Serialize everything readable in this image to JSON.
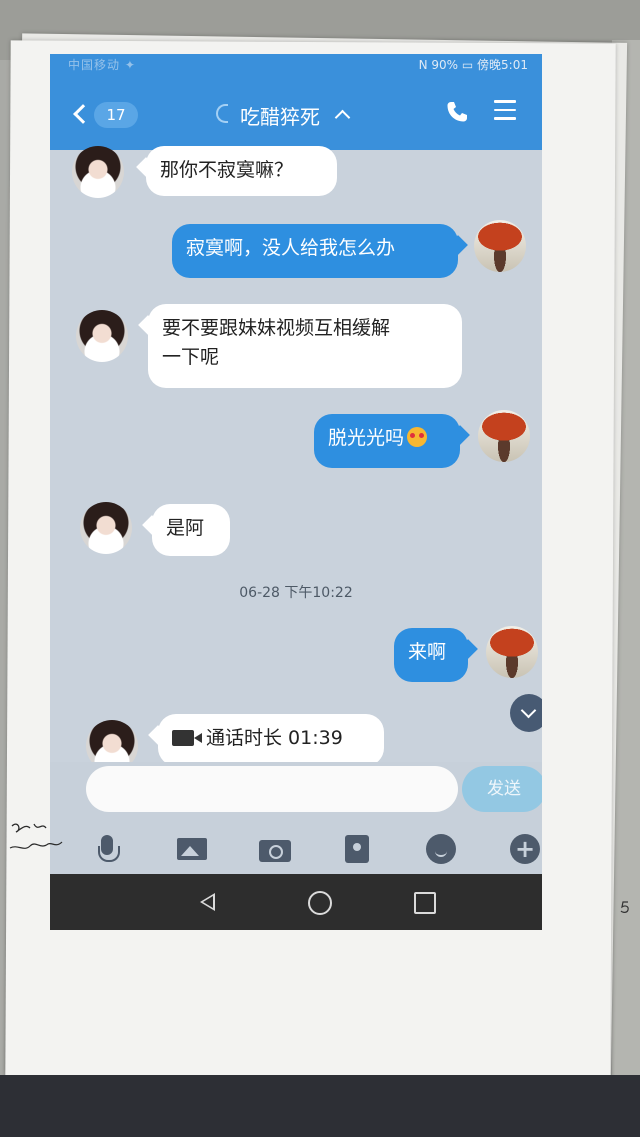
{
  "status_bar": {
    "left": "中国移动 ✦",
    "right": "N 90% ▭ 傍晚5:01"
  },
  "header": {
    "back_badge": "17",
    "title": "吃醋猝死"
  },
  "messages": [
    {
      "side": "in",
      "text": "那你不寂寞嘛？"
    },
    {
      "side": "out",
      "text": "寂寞啊，没人给我怎么办"
    },
    {
      "side": "in",
      "line1": "要不要跟妹妹视频互相缓解",
      "line2": "一下呢"
    },
    {
      "side": "out",
      "text": "脱光光吗",
      "emoji": "star-struck-emoji"
    },
    {
      "side": "in",
      "text": "是阿"
    },
    {
      "side": "out",
      "text": "来啊"
    },
    {
      "side": "in",
      "type": "video-call",
      "text": "通话时长 01:39"
    }
  ],
  "timestamp": "06-28 下午10:22",
  "input": {
    "placeholder": "",
    "send_label": "发送"
  },
  "toolbar_icons": [
    "mic-icon",
    "image-icon",
    "camera-icon",
    "red-packet-icon",
    "emoji-icon",
    "plus-icon"
  ],
  "colors": {
    "header": "#3a90db",
    "outgoing_bubble": "#2e8fe0",
    "chat_background": "#c9d2dc"
  }
}
